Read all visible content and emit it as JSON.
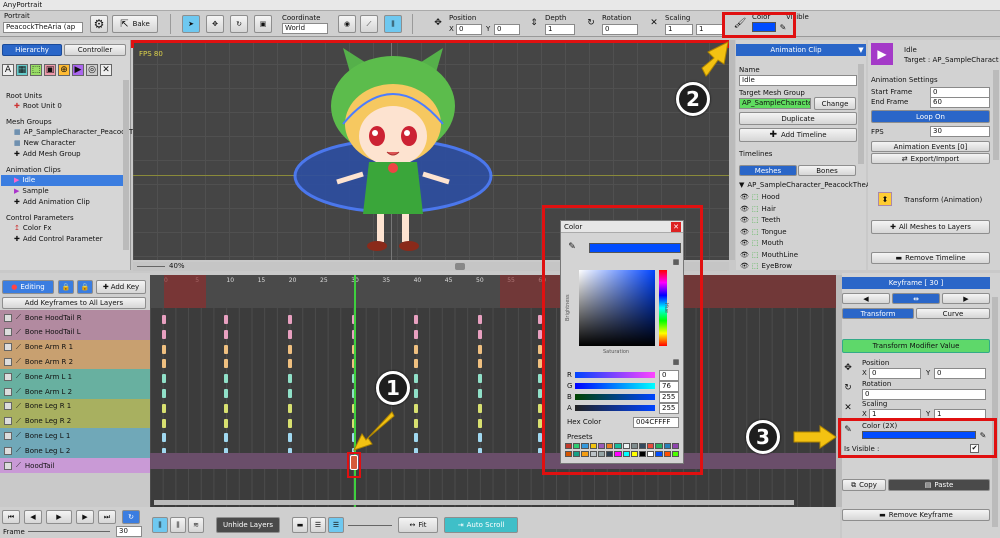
{
  "window": {
    "title": "AnyPortrait"
  },
  "toolbar": {
    "portrait_label": "Portrait",
    "portrait_value": "PeacockTheAria (ap",
    "bake": "Bake",
    "coordinate_label": "Coordinate",
    "coordinate_value": "World",
    "position_label": "Position",
    "pos_x": "0",
    "pos_y": "0",
    "depth_label": "Depth",
    "depth_value": "1",
    "rotation_label": "Rotation",
    "rotation_value": "0",
    "scaling_label": "Scaling",
    "scale_x": "1",
    "scale_y": "1",
    "color_label": "Color",
    "visible_label": "Visible",
    "x_label": "X",
    "y_label": "Y"
  },
  "left": {
    "tab_hierarchy": "Hierarchy",
    "tab_controller": "Controller",
    "root_units": "Root Units",
    "root_unit_0": "Root Unit 0",
    "mesh_groups": "Mesh Groups",
    "mesh_group_1": "AP_SampleCharacter_PeacockTheA",
    "new_character": "New Character",
    "add_mesh_group": "Add Mesh Group",
    "animation_clips": "Animation Clips",
    "idle": "Idle",
    "sample": "Sample",
    "add_animation_clip": "Add Animation Clip",
    "control_parameters": "Control Parameters",
    "color_fx": "Color Fx",
    "add_control_parameter": "Add Control Parameter"
  },
  "viewport": {
    "fps": "FPS 80",
    "zoom": "40%"
  },
  "clip": {
    "header": "Animation Clip",
    "name_label": "Name",
    "name_value": "Idle",
    "target_label": "Target Mesh Group",
    "target_value": "AP_SampleCharacter_P",
    "change": "Change",
    "duplicate": "Duplicate",
    "add_timeline": "Add Timeline",
    "timelines_label": "Timelines",
    "tab_meshes": "Meshes",
    "tab_bones": "Bones",
    "tree_root": "AP_SampleCharacter_PeacockTheA",
    "meshes": [
      "Hood",
      "Hair",
      "Teeth",
      "Tongue",
      "Mouth",
      "MouthLine",
      "EyeBrow"
    ]
  },
  "right": {
    "title": "Idle",
    "target": "Target : AP_SampleCharact",
    "settings": "Animation Settings",
    "start_frame": "Start Frame",
    "start_value": "0",
    "end_frame": "End Frame",
    "end_value": "60",
    "loop": "Loop On",
    "fps_label": "FPS",
    "fps_value": "30",
    "events": "Animation Events [0]",
    "export_import": "Export/Import",
    "transform_anim": "Transform (Animation)",
    "all_meshes": "All Meshes to Layers",
    "remove_timeline": "Remove Timeline"
  },
  "color_dialog": {
    "title": "Color",
    "brightness": "Brightness",
    "saturation": "Saturation",
    "hue": "Hue",
    "r": "R",
    "g": "G",
    "b": "B",
    "a": "A",
    "r_val": "0",
    "g_val": "76",
    "b_val": "255",
    "a_val": "255",
    "hex_label": "Hex Color",
    "hex_value": "004CFFFF",
    "presets": "Presets"
  },
  "timeline": {
    "editing": "Editing",
    "add_key": "Add Key",
    "add_all": "Add Keyframes to All Layers",
    "ticks": [
      "0",
      "5",
      "10",
      "15",
      "20",
      "25",
      "30",
      "35",
      "40",
      "45",
      "50",
      "55",
      "60"
    ],
    "layers": [
      "Bone HoodTail R",
      "Bone HoodTail L",
      "Bone Arm R 1",
      "Bone Arm R 2",
      "Bone Arm L 1",
      "Bone Arm L 2",
      "Bone Leg R 1",
      "Bone Leg R 2",
      "Bone Leg L 1",
      "Bone Leg L 2",
      "HoodTail"
    ],
    "frame_label": "Frame",
    "frame_value": "30",
    "unhide": "Unhide Layers",
    "fit": "Fit",
    "auto_scroll": "Auto Scroll"
  },
  "keyframe": {
    "header": "Keyframe [ 30 ]",
    "tab_transform": "Transform",
    "tab_curve": "Curve",
    "modifier": "Transform Modifier Value",
    "position": "Position",
    "px": "0",
    "py": "0",
    "rotation": "Rotation",
    "rot": "0",
    "scaling": "Scaling",
    "sx": "1",
    "sy": "1",
    "color": "Color (2X)",
    "visible": "Is Visible :",
    "copy": "Copy",
    "paste": "Paste",
    "remove": "Remove Keyframe",
    "x": "X",
    "y": "Y"
  },
  "callouts": {
    "one": "1",
    "two": "2",
    "three": "3"
  },
  "colors": {
    "accent": "#004CFF",
    "highlight": "#e01010",
    "arrow": "#f3c212"
  }
}
